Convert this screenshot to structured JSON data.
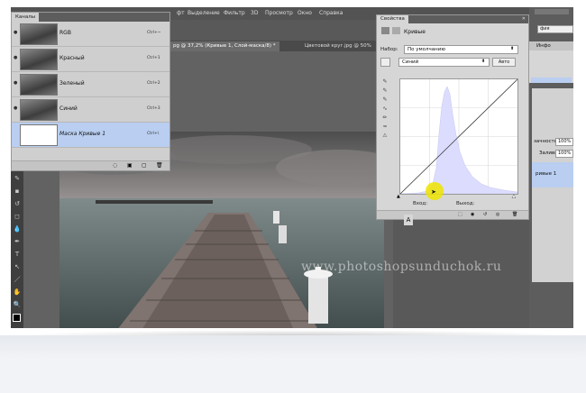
{
  "menu": [
    "фт",
    "Выделение",
    "Фильтр",
    "3D",
    "Просмотр",
    "Окно",
    "Справка"
  ],
  "doc_tabs": [
    {
      "label": "pg @ 37,2% (Кривые 1, Слой-маска/8) *",
      "active": true
    },
    {
      "label": "Цветовой круг.jpg @ 50%",
      "active": false
    }
  ],
  "channels_panel": {
    "tab": "Каналы",
    "rows": [
      {
        "name": "RGB",
        "shortcut": "Ctrl+~",
        "selected": false
      },
      {
        "name": "Красный",
        "shortcut": "Ctrl+1",
        "selected": false
      },
      {
        "name": "Зеленый",
        "shortcut": "Ctrl+2",
        "selected": false
      },
      {
        "name": "Синий",
        "shortcut": "Ctrl+3",
        "selected": false
      },
      {
        "name": "Маска Кривые 1",
        "shortcut": "Ctrl+\\",
        "selected": true
      }
    ]
  },
  "properties_panel": {
    "tab": "Свойства",
    "title": "Кривые",
    "preset_label": "Набор:",
    "preset_value": "По умолчанию",
    "channel_value": "Синий",
    "auto_button": "Авто",
    "input_label": "Вход:",
    "output_label": "Выход:"
  },
  "dock": {
    "top_field": "фия",
    "tab_info": "Инфо",
    "opacity_label": "зачность:",
    "opacity_value": "100%",
    "fill_label": "Заливка:",
    "fill_value": "100%",
    "layer_name": "ривые 1"
  },
  "watermark": "www.photoshopsunduchok.ru",
  "colors": {
    "selection": "#b9cef0",
    "histogram": "#dcdcff",
    "cursor": "#eee400"
  }
}
